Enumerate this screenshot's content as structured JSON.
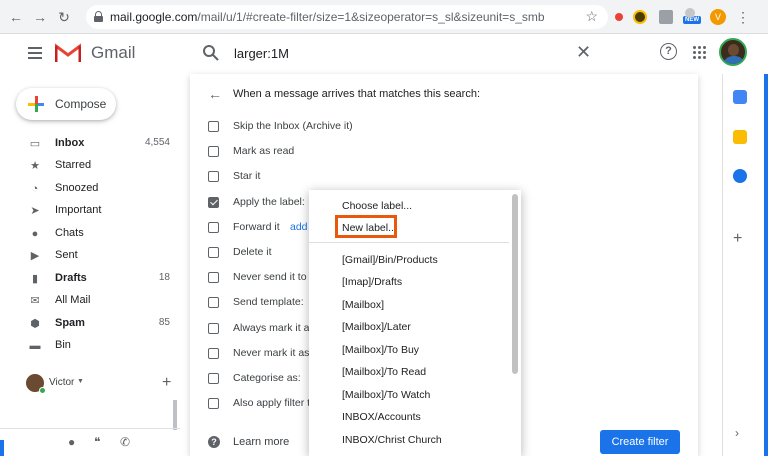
{
  "browser": {
    "url_domain": "mail.google.com",
    "url_path": "/mail/u/1/#create-filter/size=1&sizeoperator=s_sl&sizeunit=s_smb",
    "profile_initial": "V",
    "new_badge": "NEW",
    "accent_color": "#1a73e8"
  },
  "header": {
    "app_name": "Gmail",
    "search_query": "larger:1M",
    "help_glyph": "?"
  },
  "sidebar": {
    "compose_label": "Compose",
    "items": [
      {
        "label": "Inbox",
        "count": "4,554",
        "icon": "inbox-icon",
        "bold": true
      },
      {
        "label": "Starred",
        "count": "",
        "icon": "star-icon",
        "bold": false
      },
      {
        "label": "Snoozed",
        "count": "",
        "icon": "clock-icon",
        "bold": false
      },
      {
        "label": "Important",
        "count": "",
        "icon": "important-icon",
        "bold": false
      },
      {
        "label": "Chats",
        "count": "",
        "icon": "chat-icon",
        "bold": false
      },
      {
        "label": "Sent",
        "count": "",
        "icon": "send-icon",
        "bold": false
      },
      {
        "label": "Drafts",
        "count": "18",
        "icon": "draft-icon",
        "bold": true
      },
      {
        "label": "All Mail",
        "count": "",
        "icon": "mail-icon",
        "bold": false
      },
      {
        "label": "Spam",
        "count": "85",
        "icon": "spam-icon",
        "bold": true
      },
      {
        "label": "Bin",
        "count": "",
        "icon": "bin-icon",
        "bold": false
      }
    ],
    "user_name": "Victor"
  },
  "filter": {
    "title": "When a message arrives that matches this search:",
    "options": [
      {
        "label": "Skip the Inbox (Archive it)",
        "checked": false
      },
      {
        "label": "Mark as read",
        "checked": false
      },
      {
        "label": "Star it",
        "checked": false
      },
      {
        "label": "Apply the label:",
        "checked": true
      },
      {
        "label": "Forward it",
        "checked": false,
        "link": "add"
      },
      {
        "label": "Delete it",
        "checked": false
      },
      {
        "label": "Never send it to S",
        "checked": false
      },
      {
        "label": "Send template:",
        "checked": false
      },
      {
        "label": "Always mark it as",
        "checked": false
      },
      {
        "label": "Never mark it as",
        "checked": false
      },
      {
        "label": "Categorise as:",
        "checked": false
      },
      {
        "label": "Also apply filter t",
        "checked": false
      }
    ],
    "learn_more": "Learn more",
    "create_button": "Create filter"
  },
  "label_dropdown": {
    "choose": "Choose label...",
    "new_label": "New label...",
    "labels": [
      "[Gmail]/Bin/Products",
      "[Imap]/Drafts",
      "[Mailbox]",
      "[Mailbox]/Later",
      "[Mailbox]/To Buy",
      "[Mailbox]/To Read",
      "[Mailbox]/To Watch",
      "INBOX/Accounts",
      "INBOX/Christ Church"
    ],
    "highlight_color": "#e8590c"
  }
}
